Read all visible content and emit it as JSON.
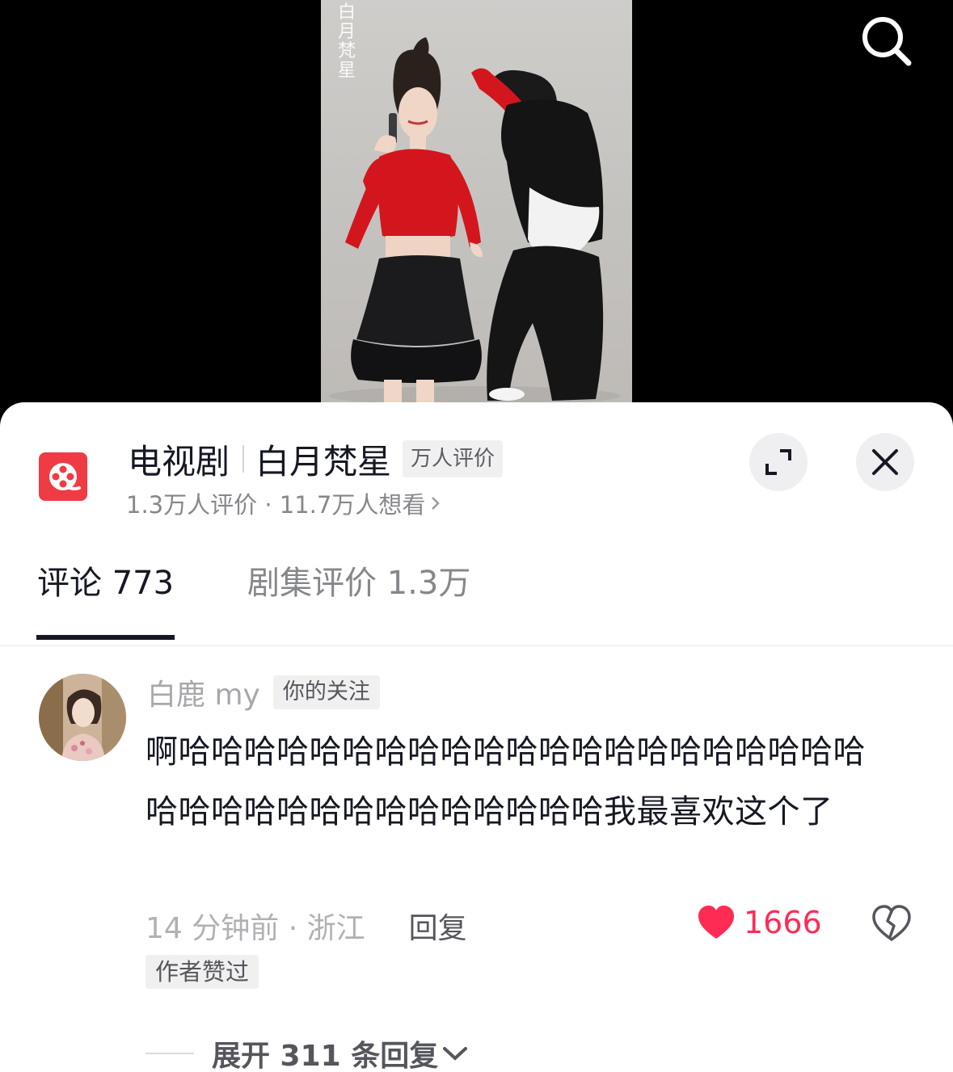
{
  "video": {
    "watermark": "白月梵星"
  },
  "show": {
    "category": "电视剧",
    "name": "白月梵星",
    "badge": "万人评价",
    "subtitle": "1.3万人评价 · 11.7万人想看",
    "icon": "film-reel-icon",
    "accent_color": "#ef3b44"
  },
  "tabs": [
    {
      "label": "评论 773",
      "active": true
    },
    {
      "label": "剧集评价 1.3万",
      "active": false
    }
  ],
  "comment": {
    "username": "白鹿 my",
    "follow_badge": "你的关注",
    "text": "啊哈哈哈哈哈哈哈哈哈哈哈哈哈哈哈哈哈哈哈哈哈哈哈哈哈哈哈哈哈哈哈哈哈哈哈我最喜欢这个了",
    "meta": "14 分钟前 · 浙江",
    "reply_label": "回复",
    "like_count": "1666",
    "liked": true,
    "like_color": "#fe2c55",
    "author_badge": "作者赞过"
  },
  "replies": {
    "expand_label": "展开 311 条回复"
  }
}
